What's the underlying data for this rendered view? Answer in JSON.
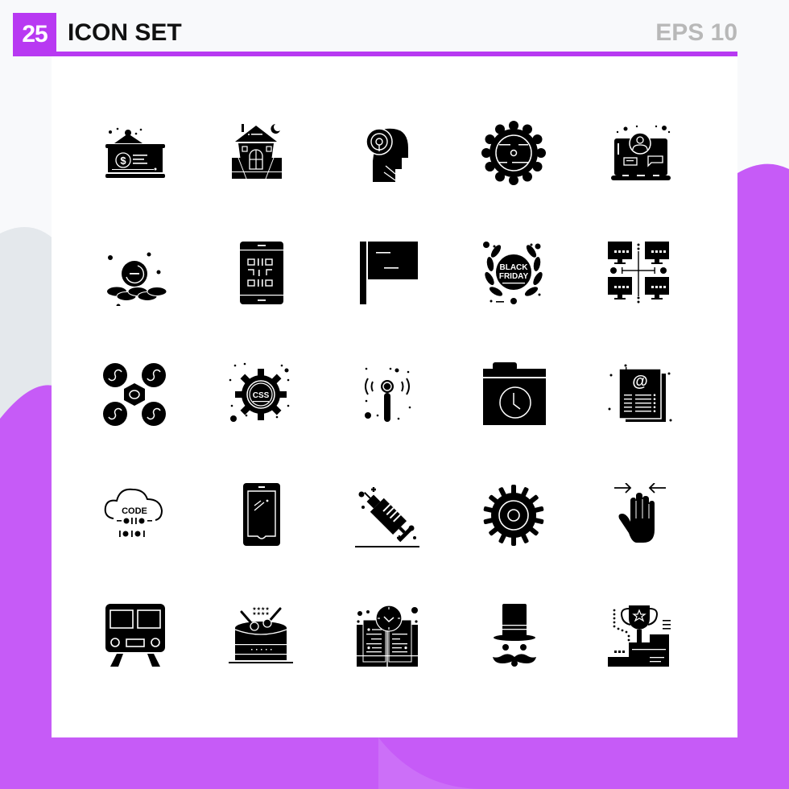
{
  "header": {
    "count": "25",
    "title": "ICON SET",
    "format": "EPS 10"
  },
  "colors": {
    "accent": "#b839f2",
    "background_blob": "#c65bf7",
    "icon": "#000000",
    "format_text": "#b8b8b8"
  },
  "icons": [
    {
      "name": "money-house",
      "label": "Bank building with dollar"
    },
    {
      "name": "haunted-house",
      "label": "Haunted house with moon"
    },
    {
      "name": "mind-maze",
      "label": "Head with maze"
    },
    {
      "name": "gear-settings",
      "label": "Gear"
    },
    {
      "name": "online-consultant",
      "label": "Laptop with user"
    },
    {
      "name": "coin-stones",
      "label": "Coin on stones"
    },
    {
      "name": "qr-phone",
      "label": "Phone with QR code"
    },
    {
      "name": "flag",
      "label": "Flag"
    },
    {
      "name": "black-friday-badge",
      "label": "Black Friday laurel",
      "text_line1": "BLACK",
      "text_line2": "FRIDAY"
    },
    {
      "name": "computer-network",
      "label": "Network of computers"
    },
    {
      "name": "drone-infinity",
      "label": "Drone with infinity rotors"
    },
    {
      "name": "css-gear",
      "label": "CSS gear",
      "text": "CSS"
    },
    {
      "name": "signal-antenna",
      "label": "Wireless antenna"
    },
    {
      "name": "folder-clock",
      "label": "Folder with clock"
    },
    {
      "name": "email-document",
      "label": "Document with at sign",
      "text": "@"
    },
    {
      "name": "code-cloud",
      "label": "Cloud code",
      "text": "CODE"
    },
    {
      "name": "smartphone",
      "label": "Smartphone"
    },
    {
      "name": "syringe",
      "label": "Syringe"
    },
    {
      "name": "cog-wheel",
      "label": "Cog wheel"
    },
    {
      "name": "hand-pinch",
      "label": "Hand with inward arrows"
    },
    {
      "name": "train-front",
      "label": "Train front"
    },
    {
      "name": "drum",
      "label": "Drum with sticks"
    },
    {
      "name": "book-clock",
      "label": "Book with clock"
    },
    {
      "name": "top-hat-mustache",
      "label": "Top hat with mustache"
    },
    {
      "name": "trophy-podium",
      "label": "Trophy on podium"
    }
  ]
}
